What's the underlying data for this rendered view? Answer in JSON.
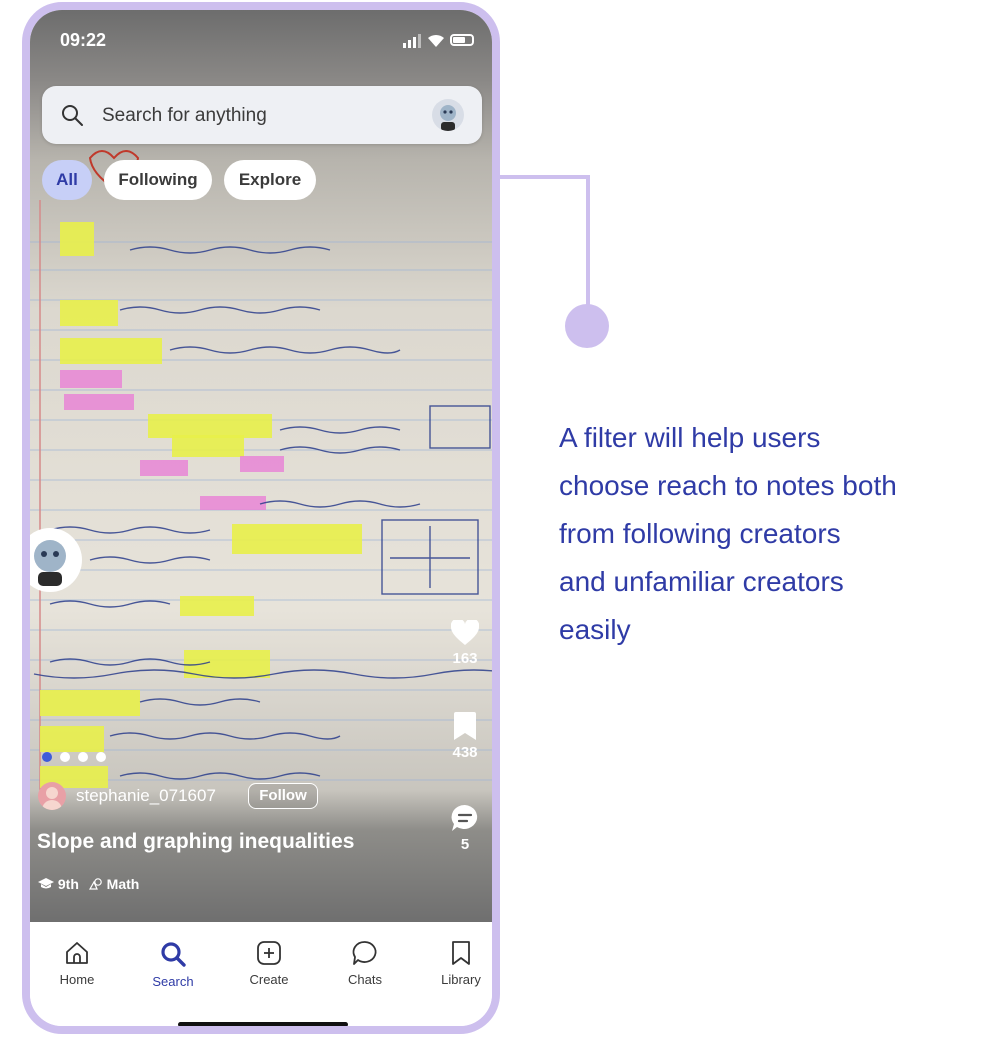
{
  "status": {
    "time": "09:22"
  },
  "search": {
    "placeholder": "Search for anything"
  },
  "tabs": [
    {
      "label": "All",
      "active": true
    },
    {
      "label": "Following",
      "active": false
    },
    {
      "label": "Explore",
      "active": false
    }
  ],
  "actions": {
    "likes": "163",
    "saves": "438",
    "comments": "5"
  },
  "carousel": {
    "total": 4,
    "current": 1
  },
  "post": {
    "creator": "stephanie_071607",
    "follow_label": "Follow",
    "title": "Slope and graphing inequalities",
    "grade": "9th",
    "subject": "Math"
  },
  "nav": [
    {
      "label": "Home",
      "icon": "home-icon"
    },
    {
      "label": "Search",
      "icon": "search-icon",
      "active": true
    },
    {
      "label": "Create",
      "icon": "plus-square-icon"
    },
    {
      "label": "Chats",
      "icon": "chat-icon"
    },
    {
      "label": "Library",
      "icon": "bookmark-icon"
    }
  ],
  "annotation": {
    "text": "A filter will help users choose reach to notes both from following creators and unfamiliar creators easily",
    "lines": [
      "A filter will help users",
      "choose reach to notes both",
      "from following creators",
      "and unfamiliar creators",
      "easily"
    ]
  },
  "colors": {
    "accent": "#2f3ba6",
    "frame": "#cdbfee",
    "tab_active_bg": "#c7cff7",
    "highlight_yellow": "#e8f04a",
    "highlight_pink": "#e97fd6"
  }
}
